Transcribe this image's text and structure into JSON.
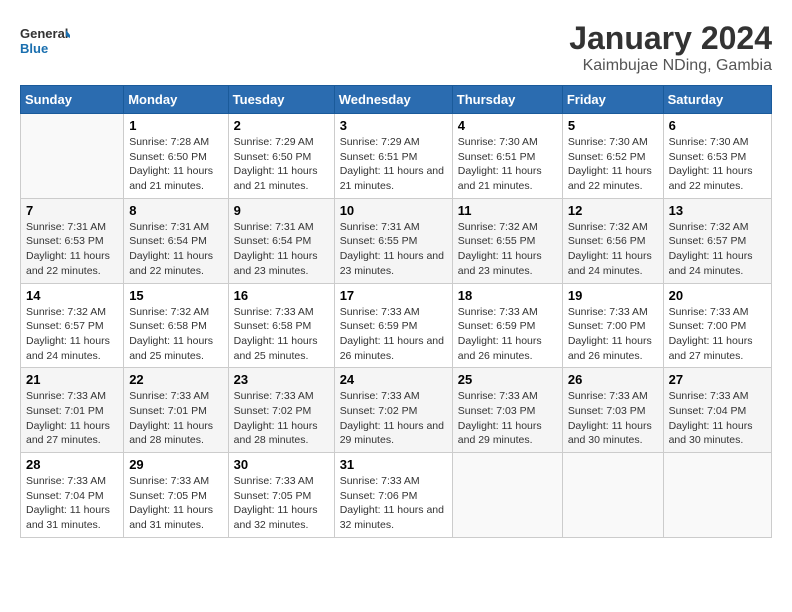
{
  "logo": {
    "line1": "General",
    "line2": "Blue"
  },
  "title": "January 2024",
  "subtitle": "Kaimbujae NDing, Gambia",
  "headers": [
    "Sunday",
    "Monday",
    "Tuesday",
    "Wednesday",
    "Thursday",
    "Friday",
    "Saturday"
  ],
  "weeks": [
    [
      {
        "day": "",
        "info": ""
      },
      {
        "day": "1",
        "info": "Sunrise: 7:28 AM\nSunset: 6:50 PM\nDaylight: 11 hours and 21 minutes."
      },
      {
        "day": "2",
        "info": "Sunrise: 7:29 AM\nSunset: 6:50 PM\nDaylight: 11 hours and 21 minutes."
      },
      {
        "day": "3",
        "info": "Sunrise: 7:29 AM\nSunset: 6:51 PM\nDaylight: 11 hours and 21 minutes."
      },
      {
        "day": "4",
        "info": "Sunrise: 7:30 AM\nSunset: 6:51 PM\nDaylight: 11 hours and 21 minutes."
      },
      {
        "day": "5",
        "info": "Sunrise: 7:30 AM\nSunset: 6:52 PM\nDaylight: 11 hours and 22 minutes."
      },
      {
        "day": "6",
        "info": "Sunrise: 7:30 AM\nSunset: 6:53 PM\nDaylight: 11 hours and 22 minutes."
      }
    ],
    [
      {
        "day": "7",
        "info": "Sunrise: 7:31 AM\nSunset: 6:53 PM\nDaylight: 11 hours and 22 minutes."
      },
      {
        "day": "8",
        "info": "Sunrise: 7:31 AM\nSunset: 6:54 PM\nDaylight: 11 hours and 22 minutes."
      },
      {
        "day": "9",
        "info": "Sunrise: 7:31 AM\nSunset: 6:54 PM\nDaylight: 11 hours and 23 minutes."
      },
      {
        "day": "10",
        "info": "Sunrise: 7:31 AM\nSunset: 6:55 PM\nDaylight: 11 hours and 23 minutes."
      },
      {
        "day": "11",
        "info": "Sunrise: 7:32 AM\nSunset: 6:55 PM\nDaylight: 11 hours and 23 minutes."
      },
      {
        "day": "12",
        "info": "Sunrise: 7:32 AM\nSunset: 6:56 PM\nDaylight: 11 hours and 24 minutes."
      },
      {
        "day": "13",
        "info": "Sunrise: 7:32 AM\nSunset: 6:57 PM\nDaylight: 11 hours and 24 minutes."
      }
    ],
    [
      {
        "day": "14",
        "info": "Sunrise: 7:32 AM\nSunset: 6:57 PM\nDaylight: 11 hours and 24 minutes."
      },
      {
        "day": "15",
        "info": "Sunrise: 7:32 AM\nSunset: 6:58 PM\nDaylight: 11 hours and 25 minutes."
      },
      {
        "day": "16",
        "info": "Sunrise: 7:33 AM\nSunset: 6:58 PM\nDaylight: 11 hours and 25 minutes."
      },
      {
        "day": "17",
        "info": "Sunrise: 7:33 AM\nSunset: 6:59 PM\nDaylight: 11 hours and 26 minutes."
      },
      {
        "day": "18",
        "info": "Sunrise: 7:33 AM\nSunset: 6:59 PM\nDaylight: 11 hours and 26 minutes."
      },
      {
        "day": "19",
        "info": "Sunrise: 7:33 AM\nSunset: 7:00 PM\nDaylight: 11 hours and 26 minutes."
      },
      {
        "day": "20",
        "info": "Sunrise: 7:33 AM\nSunset: 7:00 PM\nDaylight: 11 hours and 27 minutes."
      }
    ],
    [
      {
        "day": "21",
        "info": "Sunrise: 7:33 AM\nSunset: 7:01 PM\nDaylight: 11 hours and 27 minutes."
      },
      {
        "day": "22",
        "info": "Sunrise: 7:33 AM\nSunset: 7:01 PM\nDaylight: 11 hours and 28 minutes."
      },
      {
        "day": "23",
        "info": "Sunrise: 7:33 AM\nSunset: 7:02 PM\nDaylight: 11 hours and 28 minutes."
      },
      {
        "day": "24",
        "info": "Sunrise: 7:33 AM\nSunset: 7:02 PM\nDaylight: 11 hours and 29 minutes."
      },
      {
        "day": "25",
        "info": "Sunrise: 7:33 AM\nSunset: 7:03 PM\nDaylight: 11 hours and 29 minutes."
      },
      {
        "day": "26",
        "info": "Sunrise: 7:33 AM\nSunset: 7:03 PM\nDaylight: 11 hours and 30 minutes."
      },
      {
        "day": "27",
        "info": "Sunrise: 7:33 AM\nSunset: 7:04 PM\nDaylight: 11 hours and 30 minutes."
      }
    ],
    [
      {
        "day": "28",
        "info": "Sunrise: 7:33 AM\nSunset: 7:04 PM\nDaylight: 11 hours and 31 minutes."
      },
      {
        "day": "29",
        "info": "Sunrise: 7:33 AM\nSunset: 7:05 PM\nDaylight: 11 hours and 31 minutes."
      },
      {
        "day": "30",
        "info": "Sunrise: 7:33 AM\nSunset: 7:05 PM\nDaylight: 11 hours and 32 minutes."
      },
      {
        "day": "31",
        "info": "Sunrise: 7:33 AM\nSunset: 7:06 PM\nDaylight: 11 hours and 32 minutes."
      },
      {
        "day": "",
        "info": ""
      },
      {
        "day": "",
        "info": ""
      },
      {
        "day": "",
        "info": ""
      }
    ]
  ]
}
